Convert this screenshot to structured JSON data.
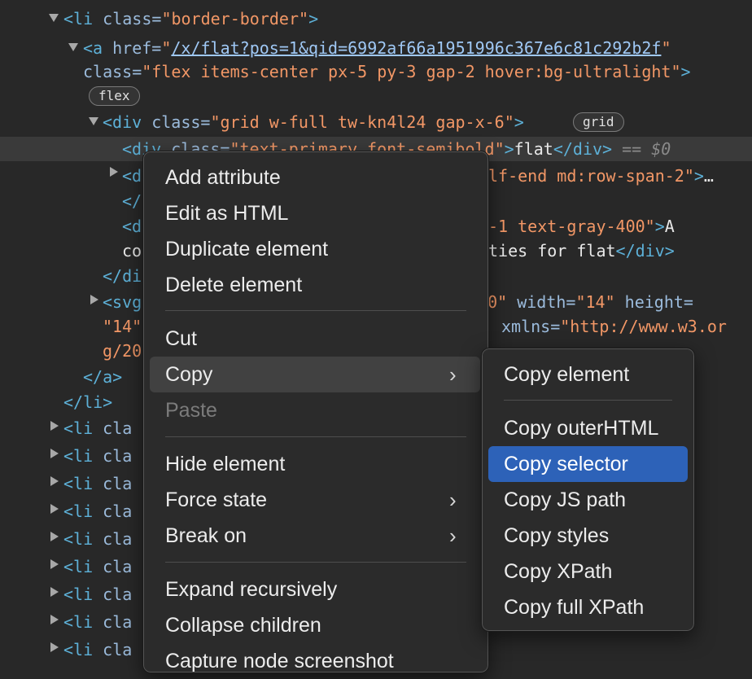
{
  "dom": {
    "l1": {
      "open": "<",
      "tag": "li",
      "attr": " class=",
      "val": "\"border-border\"",
      "close": ">"
    },
    "l2": {
      "open": "<",
      "tag": "a",
      "attr": " href=",
      "q": "\"",
      "link": "/x/flat?pos=1&qid=6992af66a1951996c367e6c81c292b2f",
      "q2": "\""
    },
    "l3": {
      "attr": "class=",
      "val": "\"flex items-center px-5 py-3 gap-2 hover:bg-ultralight\"",
      "close": ">"
    },
    "badge_flex": "flex",
    "l4": {
      "open": "<",
      "tag": "div",
      "attr": " class=",
      "val": "\"grid w-full tw-kn4l24 gap-x-6\"",
      "close": ">"
    },
    "badge_grid": "grid",
    "l5": {
      "open": "<",
      "tag": "div",
      "attr": " class=",
      "val": "\"text-primary font-semibold\"",
      "close": ">",
      "text": "flat",
      "endtag": "</div>",
      "eq": " == ",
      "dollar": "$0"
    },
    "l6": {
      "open": "<d",
      "val": "lf-end md:row-span-2\"",
      "close": ">",
      "ellipsis": "…"
    },
    "l7": {
      "open": "</"
    },
    "l8": {
      "open": "<d",
      "val": "-1 text-gray-400\"",
      "close": ">",
      "text": "A"
    },
    "l9": {
      "pre": "co",
      "text": "ties for flat",
      "endtag": "</div>"
    },
    "l10": {
      "open": "</di"
    },
    "l11": {
      "open": "<svg",
      "val": "k-0\"",
      "attr": " width=",
      "val2": "\"14\"",
      "attr2": " height="
    },
    "l12": {
      "val": "\"14\"",
      "attr": "xmlns=",
      "val2": "\"http://www.w3.or"
    },
    "l13": {
      "val": "g/20"
    },
    "l14": {
      "tag": "</a>"
    },
    "l15": {
      "tag": "</li>"
    },
    "collapsed_li": {
      "open": "<",
      "tag": "li",
      "attr": " cla"
    }
  },
  "context_menu": {
    "items": [
      {
        "label": "Add attribute"
      },
      {
        "label": "Edit as HTML"
      },
      {
        "label": "Duplicate element"
      },
      {
        "label": "Delete element"
      },
      {
        "label": "Cut"
      },
      {
        "label": "Copy"
      },
      {
        "label": "Paste"
      },
      {
        "label": "Hide element"
      },
      {
        "label": "Force state"
      },
      {
        "label": "Break on"
      },
      {
        "label": "Expand recursively"
      },
      {
        "label": "Collapse children"
      },
      {
        "label": "Capture node screenshot"
      }
    ]
  },
  "copy_submenu": {
    "items": [
      {
        "label": "Copy element"
      },
      {
        "label": "Copy outerHTML"
      },
      {
        "label": "Copy selector"
      },
      {
        "label": "Copy JS path"
      },
      {
        "label": "Copy styles"
      },
      {
        "label": "Copy XPath"
      },
      {
        "label": "Copy full XPath"
      }
    ]
  },
  "colors": {
    "background": "#282828",
    "tag": "#5db0d7",
    "attribute": "#9bbbdc",
    "value": "#f29766",
    "highlight": "#2d62b8"
  }
}
